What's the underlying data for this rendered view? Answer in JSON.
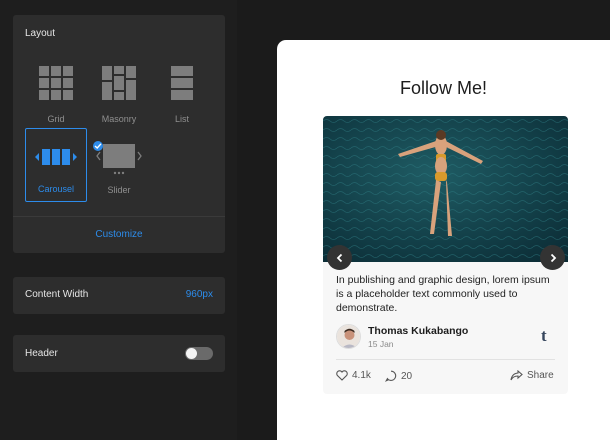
{
  "layout": {
    "title": "Layout",
    "options": [
      {
        "label": "Grid",
        "icon": "grid-icon"
      },
      {
        "label": "Masonry",
        "icon": "masonry-icon"
      },
      {
        "label": "List",
        "icon": "list-icon"
      },
      {
        "label": "Carousel",
        "icon": "carousel-icon",
        "selected": true
      },
      {
        "label": "Slider",
        "icon": "slider-icon"
      }
    ],
    "customize_label": "Customize"
  },
  "content_width": {
    "label": "Content Width",
    "value": "960px"
  },
  "header": {
    "label": "Header",
    "enabled": false
  },
  "preview": {
    "title": "Follow Me!",
    "post": {
      "text": "In publishing and graphic design, lorem ipsum is a placeholder text commonly used to demonstrate.",
      "author": "Thomas Kukabango",
      "date": "15 Jan",
      "source_icon": "tumblr-icon",
      "source_glyph": "t",
      "likes": "4.1k",
      "comments": "20",
      "share_label": "Share"
    }
  },
  "colors": {
    "accent": "#2d8ceb",
    "panel_bg": "#1e1e1e",
    "card_bg": "#2d2d2d",
    "tumblr": "#36465d"
  }
}
